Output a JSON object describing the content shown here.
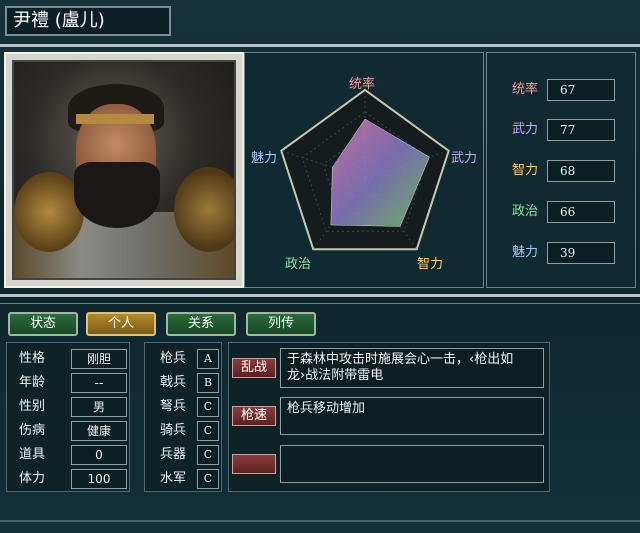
{
  "header": {
    "name": "尹禮 (盧儿)"
  },
  "radar": {
    "labels": {
      "top": "统率",
      "right": "武力",
      "bottom_right": "智力",
      "bottom_left": "政治",
      "left": "魅力"
    },
    "values": {
      "tongshuai": 67,
      "wuli": 77,
      "zhili": 68,
      "zhengzhi": 66,
      "meili": 39
    },
    "max": 100
  },
  "stats": [
    {
      "label": "统率",
      "value": "67",
      "color": "#ff9a9a"
    },
    {
      "label": "武力",
      "value": "77",
      "color": "#c8a8ff"
    },
    {
      "label": "智力",
      "value": "68",
      "color": "#ffd36a"
    },
    {
      "label": "政治",
      "value": "66",
      "color": "#8fe3a4"
    },
    {
      "label": "魅力",
      "value": "39",
      "color": "#a8c8ff"
    }
  ],
  "tabs": [
    {
      "label": "状态",
      "active": false
    },
    {
      "label": "个人",
      "active": true
    },
    {
      "label": "关系",
      "active": false
    },
    {
      "label": "列传",
      "active": false
    }
  ],
  "info": [
    {
      "label": "性格",
      "value": "刚胆"
    },
    {
      "label": "年龄",
      "value": "--"
    },
    {
      "label": "性别",
      "value": "男"
    },
    {
      "label": "伤病",
      "value": "健康"
    },
    {
      "label": "道具",
      "value": "0"
    },
    {
      "label": "体力",
      "value": "100"
    }
  ],
  "troops": [
    {
      "name": "枪兵",
      "grade": "A"
    },
    {
      "name": "戟兵",
      "grade": "B"
    },
    {
      "name": "弩兵",
      "grade": "C"
    },
    {
      "name": "骑兵",
      "grade": "C"
    },
    {
      "name": "兵器",
      "grade": "C"
    },
    {
      "name": "水军",
      "grade": "C"
    }
  ],
  "skills": [
    {
      "name": "乱战",
      "desc": "于森林中攻击时施展会心一击，‹枪出如龙›战法附带雷电"
    },
    {
      "name": "枪速",
      "desc": "枪兵移动增加"
    },
    {
      "name": "",
      "desc": ""
    }
  ]
}
